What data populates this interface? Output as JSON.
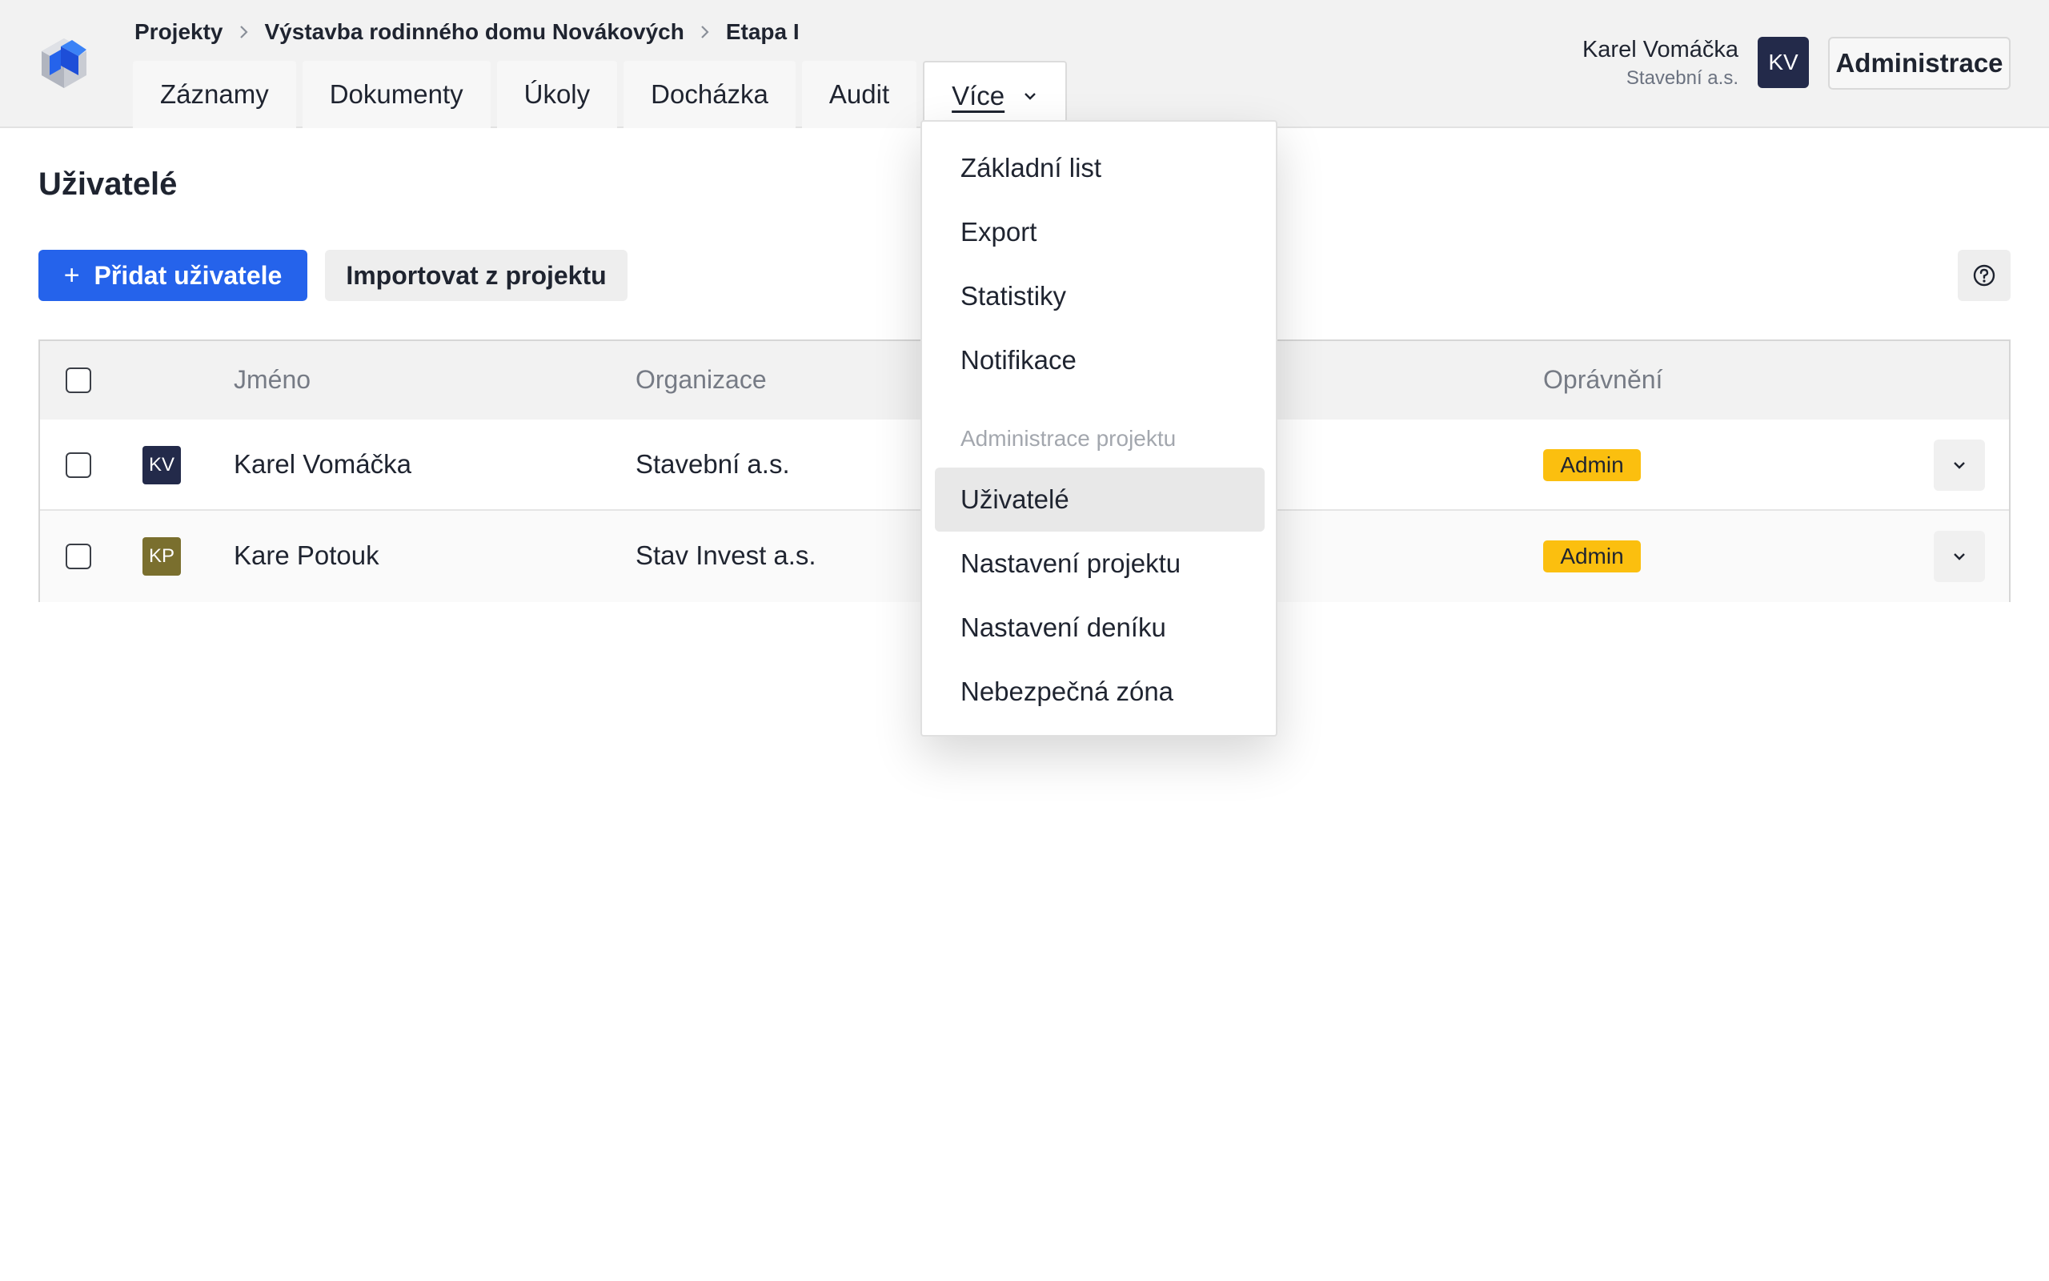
{
  "breadcrumb": [
    "Projekty",
    "Výstavba rodinného domu Novákových",
    "Etapa I"
  ],
  "tabs": [
    {
      "label": "Záznamy"
    },
    {
      "label": "Dokumenty"
    },
    {
      "label": "Úkoly"
    },
    {
      "label": "Docházka"
    },
    {
      "label": "Audit"
    },
    {
      "label": "Více"
    }
  ],
  "user": {
    "name": "Karel Vomáčka",
    "org": "Stavební a.s.",
    "initials": "KV"
  },
  "admin_button": "Administrace",
  "page": {
    "title": "Uživatelé",
    "add_button": "Přidat uživatele",
    "add_icon": "+",
    "import_button": "Importovat z projektu"
  },
  "table": {
    "columns": [
      "Jméno",
      "Organizace",
      "Oprávnění"
    ],
    "rows": [
      {
        "initials": "KV",
        "avatar_color": "#232a4a",
        "name": "Karel Vomáčka",
        "org": "Stavební a.s.",
        "role": "Admin"
      },
      {
        "initials": "KP",
        "avatar_color": "#7a6f2e",
        "name": "Kare Potouk",
        "org": "Stav Invest a.s.",
        "role": "Admin"
      }
    ]
  },
  "dropdown": {
    "items": [
      "Základní list",
      "Export",
      "Statistiky",
      "Notifikace"
    ],
    "section_heading": "Administrace projektu",
    "admin_items": [
      "Uživatelé",
      "Nastavení projektu",
      "Nastavení deníku",
      "Nebezpečná zóna"
    ],
    "selected": "Uživatelé"
  },
  "colors": {
    "primary": "#2563eb",
    "badge": "#fbbf0f",
    "header_bg": "#f2f2f2"
  }
}
